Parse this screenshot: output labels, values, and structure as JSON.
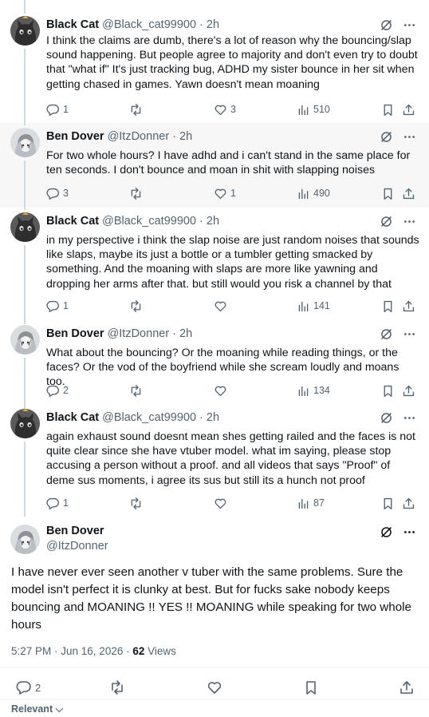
{
  "replies": [
    {
      "name": "Black Cat",
      "handle": "@Black_cat99900",
      "time": "2h",
      "text": "I think the claims are dumb, there's a lot of reason why the bouncing/slap sound happening. But people agree to majority and don't even try to doubt that \"what if\" It's just tracking bug, ADHD my sister bounce in her sit when getting chased in games. Yawn doesn't mean moaning",
      "replies": "1",
      "retweets": "",
      "likes": "3",
      "views": "510",
      "avatar": "cat"
    },
    {
      "name": "Ben Dover",
      "handle": "@ItzDonner",
      "time": "2h",
      "text": "For two whole hours? I have adhd and i can't stand in the same place for ten seconds. I don't bounce and moan in shit with slapping noises",
      "replies": "3",
      "retweets": "",
      "likes": "1",
      "views": "490",
      "avatar": "anime"
    },
    {
      "name": "Black Cat",
      "handle": "@Black_cat99900",
      "time": "2h",
      "text": "in my perspective i think the slap noise are just random noises that sounds like slaps, maybe its just a bottle or a tumbler getting smacked by something. And the moaning with slaps are more like yawning and dropping her arms after that. but still would you risk a channel by that",
      "replies": "1",
      "retweets": "",
      "likes": "",
      "views": "141",
      "avatar": "cat"
    },
    {
      "name": "Ben Dover",
      "handle": "@ItzDonner",
      "time": "2h",
      "text": "What about the bouncing? Or the moaning while reading things, or the faces? Or the vod of the boyfriend while she scream loudly and moans too.",
      "replies": "2",
      "retweets": "",
      "likes": "",
      "views": "134",
      "avatar": "anime"
    },
    {
      "name": "Black Cat",
      "handle": "@Black_cat99900",
      "time": "2h",
      "text": "again exhaust sound doesnt mean shes getting railed and the faces is not quite clear since she have vtuber model. what im saying, please stop accusing a person without a proof. and all videos that says \"Proof\" of deme sus moments, i agree its sus but still its a hunch not proof",
      "replies": "1",
      "retweets": "",
      "likes": "",
      "views": "87",
      "avatar": "cat"
    }
  ],
  "focal": {
    "name": "Ben Dover",
    "handle": "@ItzDonner",
    "text": "I have never ever seen another v tuber with the same problems. Sure the model isn't perfect it is clunky at best. But for fucks sake nobody keeps bouncing and MOANING !! YES !! MOANING while speaking for two whole hours",
    "time": "5:27 PM · Jun 16, 2026 · ",
    "views_count": "62",
    "views_label": " Views",
    "replies": "2"
  },
  "sort_label": "Relevant",
  "colors": {
    "text": "#0f1419",
    "secondary": "#536471",
    "highlight": "#f7f7f7",
    "border": "#eff3f4"
  }
}
